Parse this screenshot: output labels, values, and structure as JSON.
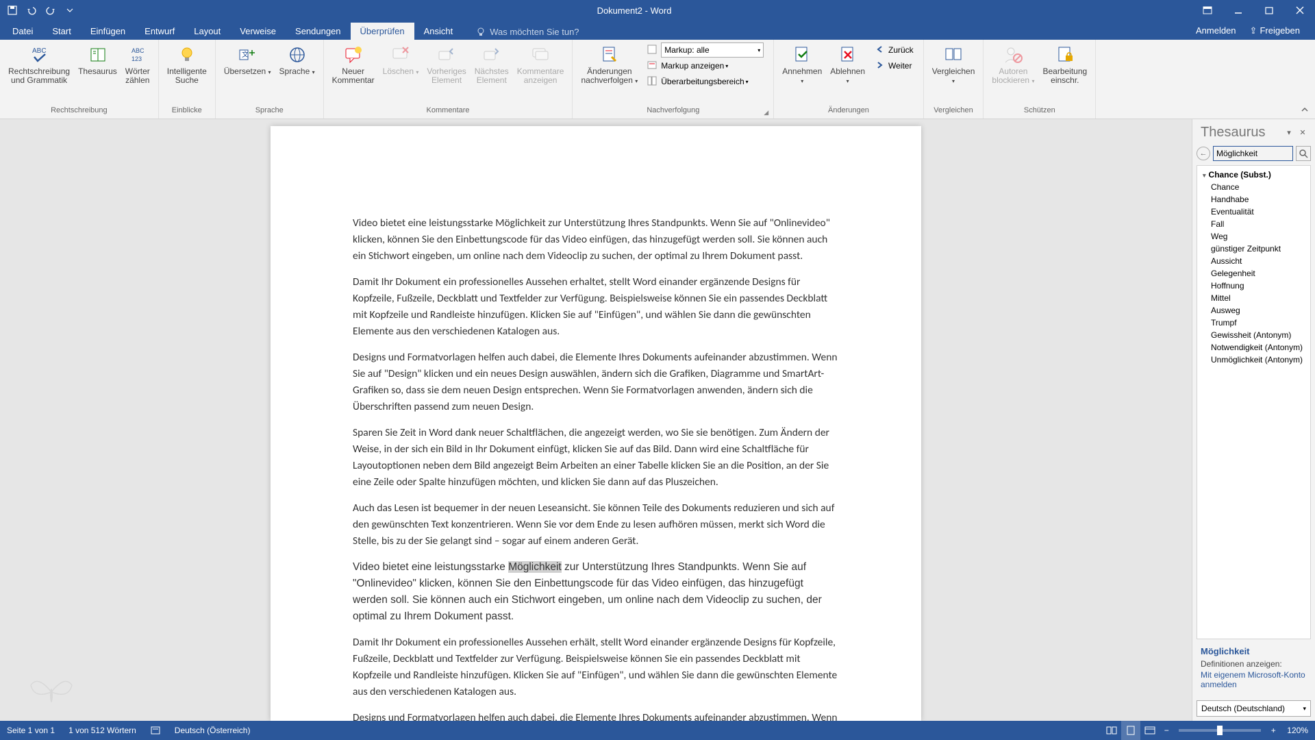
{
  "app": {
    "title": "Dokument2 - Word"
  },
  "tabs": {
    "file": "Datei",
    "home": "Start",
    "insert": "Einfügen",
    "design": "Entwurf",
    "layout": "Layout",
    "references": "Verweise",
    "mailings": "Sendungen",
    "review": "Überprüfen",
    "view": "Ansicht",
    "tellme_placeholder": "Was möchten Sie tun?",
    "signin": "Anmelden",
    "share": "Freigeben"
  },
  "ribbon": {
    "proofing": {
      "spelling": "Rechtschreibung\nund Grammatik",
      "thesaurus": "Thesaurus",
      "wordcount": "Wörter\nzählen",
      "label": "Rechtschreibung"
    },
    "insights": {
      "smart": "Intelligente\nSuche",
      "label": "Einblicke"
    },
    "language": {
      "translate": "Übersetzen",
      "language": "Sprache",
      "label": "Sprache"
    },
    "comments": {
      "new": "Neuer\nKommentar",
      "delete": "Löschen",
      "prev": "Vorheriges\nElement",
      "next": "Nächstes\nElement",
      "show": "Kommentare\nanzeigen",
      "label": "Kommentare"
    },
    "tracking": {
      "track": "Änderungen\nnachverfolgen",
      "markup_prefix": "Markup:",
      "markup_value": "alle",
      "show_markup": "Markup anzeigen",
      "reviewing": "Überarbeitungsbereich",
      "label": "Nachverfolgung"
    },
    "changes": {
      "accept": "Annehmen",
      "reject": "Ablehnen",
      "back": "Zurück",
      "forward": "Weiter",
      "label": "Änderungen"
    },
    "compare": {
      "compare": "Vergleichen",
      "label": "Vergleichen"
    },
    "protect": {
      "block": "Autoren\nblockieren",
      "restrict": "Bearbeitung\neinschr.",
      "label": "Schützen"
    }
  },
  "document": {
    "p1": "Video bietet eine leistungsstarke Möglichkeit zur Unterstützung Ihres Standpunkts. Wenn Sie auf \"Onlinevideo\" klicken, können Sie den Einbettungscode für das Video einfügen, das hinzugefügt werden soll. Sie können auch ein Stichwort eingeben, um online nach dem Videoclip zu suchen, der optimal zu Ihrem Dokument passt.",
    "p2": "Damit Ihr Dokument ein professionelles Aussehen erhaltet, stellt Word einander ergänzende Designs für Kopfzeile, Fußzeile, Deckblatt und Textfelder zur Verfügung. Beispielsweise können Sie ein passendes Deckblatt mit Kopfzeile und Randleiste hinzufügen. Klicken Sie auf \"Einfügen\", und wählen Sie dann die gewünschten Elemente aus den verschiedenen Katalogen aus.",
    "p3": "Designs und Formatvorlagen helfen auch dabei, die Elemente Ihres Dokuments aufeinander abzustimmen. Wenn Sie auf \"Design\" klicken und ein neues Design auswählen, ändern sich die Grafiken, Diagramme und SmartArt-Grafiken so, dass sie dem neuen Design entsprechen. Wenn Sie Formatvorlagen anwenden, ändern sich die Überschriften passend zum neuen Design.",
    "p4": "Sparen Sie Zeit in Word dank neuer Schaltflächen, die angezeigt werden, wo Sie sie benötigen. Zum Ändern der Weise, in der sich ein Bild in Ihr Dokument einfügt, klicken Sie auf das Bild. Dann wird eine Schaltfläche für Layoutoptionen neben dem Bild angezeigt Beim Arbeiten an einer Tabelle klicken Sie an die Position, an der Sie eine Zeile oder Spalte hinzufügen möchten, und klicken Sie dann auf das Pluszeichen.",
    "p5": "Auch das Lesen ist bequemer in der neuen Leseansicht. Sie können Teile des Dokuments reduzieren und sich auf den gewünschten Text konzentrieren. Wenn Sie vor dem Ende zu lesen aufhören müssen, merkt sich Word die Stelle, bis zu der Sie gelangt sind – sogar auf einem anderen Gerät.",
    "p6_pre": "Video bietet eine leistungsstarke ",
    "p6_hl": "Möglichkeit",
    "p6_post": " zur Unterstützung Ihres Standpunkts. Wenn Sie auf \"Onlinevideo\" klicken, können Sie den Einbettungscode für das Video einfügen, das hinzugefügt werden soll. Sie können auch ein Stichwort eingeben, um online nach dem Videoclip zu suchen, der optimal zu Ihrem Dokument passt.",
    "p7": "Damit Ihr Dokument ein professionelles Aussehen erhält, stellt Word einander ergänzende Designs für Kopfzeile, Fußzeile, Deckblatt und Textfelder zur Verfügung. Beispielsweise können Sie ein passendes Deckblatt mit Kopfzeile und Randleiste hinzufügen. Klicken Sie auf \"Einfügen\", und wählen Sie dann die gewünschten Elemente aus den verschiedenen Katalogen aus.",
    "p8": "Designs und Formatvorlagen helfen auch dabei, die Elemente Ihres Dokuments aufeinander abzustimmen. Wenn Sie auf \"Design\" klicken und ein neues Design auswählen, ändern sich die"
  },
  "thesaurus": {
    "title": "Thesaurus",
    "search_value": "Möglichkeit",
    "group_head": "Chance (Subst.)",
    "items": [
      "Chance",
      "Handhabe",
      "Eventualität",
      "Fall",
      "Weg",
      "günstiger Zeitpunkt",
      "Aussicht",
      "Gelegenheit",
      "Hoffnung",
      "Mittel",
      "Ausweg",
      "Trumpf",
      "Gewissheit (Antonym)",
      "Notwendigkeit (Antonym)",
      "Unmöglichkeit (Antonym)"
    ],
    "footer_word": "Möglichkeit",
    "footer_label": "Definitionen anzeigen:",
    "footer_link": "Mit eigenem Microsoft-Konto anmelden",
    "lang": "Deutsch (Deutschland)"
  },
  "statusbar": {
    "page": "Seite 1 von 1",
    "words": "1 von 512 Wörtern",
    "lang": "Deutsch (Österreich)",
    "zoom": "120%"
  }
}
